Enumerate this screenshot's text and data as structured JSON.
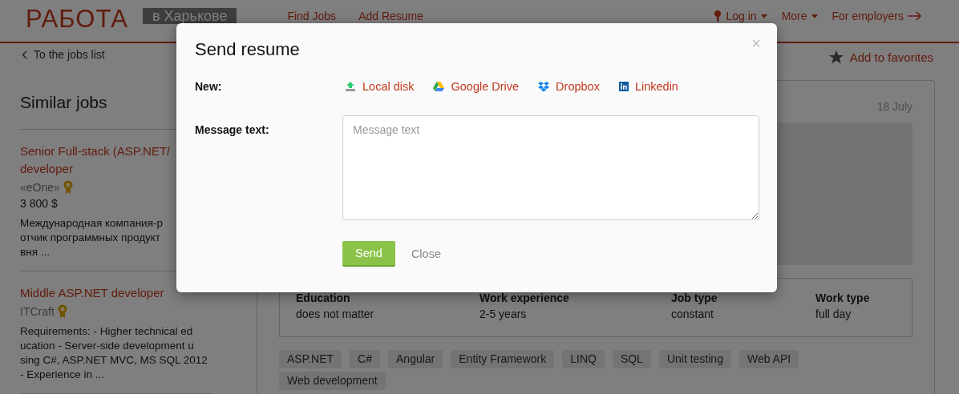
{
  "header": {
    "logo": "РАБОТА",
    "city": "в Харькове",
    "nav": [
      "Find Jobs",
      "Add Resume"
    ],
    "login": "Log in",
    "more": "More",
    "employers": "For employers"
  },
  "back_link": "To the jobs list",
  "favorite": "Add to favorites",
  "similar_jobs": {
    "title": "Similar jobs",
    "jobs": [
      {
        "title": [
          "Senior Full-stack (ASP.NET/",
          "developer"
        ],
        "company": "«eOne»",
        "salary": "3 800 $",
        "description": [
          "Международная компания-р",
          "отчик программных продукт",
          "вня ..."
        ]
      },
      {
        "title": [
          "Middle ASP.NET developer"
        ],
        "company": "ITCraft",
        "description": [
          "Requirements: - Higher technical ed",
          "ucation - Server-side development u",
          "sing C#, ASP.NET MVC, MS SQL 2012",
          "- Experience in ..."
        ]
      }
    ]
  },
  "vacancy": {
    "date": "18 July",
    "details": [
      {
        "label": "Education",
        "value": "does not matter"
      },
      {
        "label": "Work experience",
        "value": "2-5 years"
      },
      {
        "label": "Job type",
        "value": "constant"
      },
      {
        "label": "Work type",
        "value": "full day"
      }
    ],
    "tags": [
      "ASP.NET",
      "C#",
      "Angular",
      "Entity Framework",
      "LINQ",
      "SQL",
      "Unit testing",
      "Web API",
      "Web development"
    ]
  },
  "modal": {
    "title": "Send resume",
    "close_icon": "×",
    "new_label": "New:",
    "sources": [
      {
        "kind": "local",
        "label": "Local disk"
      },
      {
        "kind": "gdrive",
        "label": "Google Drive"
      },
      {
        "kind": "dropbox",
        "label": "Dropbox"
      },
      {
        "kind": "linkedin",
        "label": "Linkedin"
      }
    ],
    "message_label": "Message text:",
    "message_placeholder": "Message text",
    "send": "Send",
    "close": "Close"
  }
}
